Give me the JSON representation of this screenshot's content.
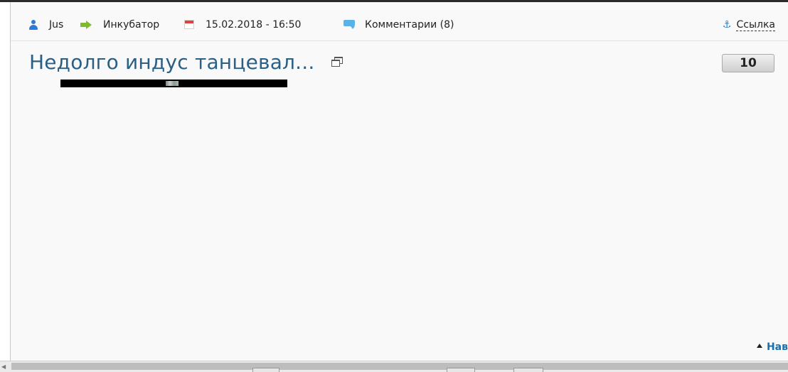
{
  "meta": {
    "author": "Jus",
    "category": "Инкубатор",
    "datetime": "15.02.2018 - 16:50",
    "comments": "Комментарии (8)",
    "link_label": "Ссылка"
  },
  "post": {
    "title": "Недолго индус танцевал...",
    "rating": "10"
  },
  "footer": {
    "nav_label": "Нав"
  },
  "icons": {
    "author": "user-icon",
    "category": "arrow-right-icon",
    "date": "calendar-icon",
    "comments": "comment-icon",
    "link": "anchor-icon",
    "title": "popup-window-icon",
    "nav": "triangle-up-icon"
  },
  "colors": {
    "title": "#2a5f86",
    "link_accent": "#1a6fae",
    "user_icon": "#2d7bd6",
    "arrow_icon": "#7dbb2d",
    "calendar_icon": "#e04040",
    "comment_icon": "#5ab3e6"
  }
}
